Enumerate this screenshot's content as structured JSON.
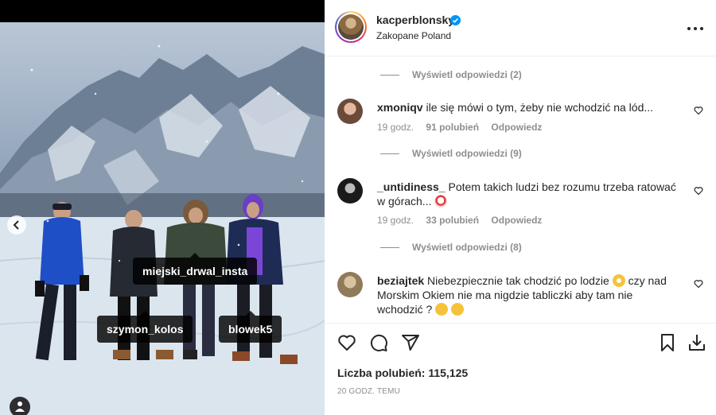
{
  "photo": {
    "tags": [
      "miejski_drwal_insta",
      "szymon_kolos",
      "blowek5"
    ]
  },
  "post": {
    "username": "kacperblonsky",
    "location": "Zakopane Poland",
    "likes_text": "Liczba polubień: 115,125",
    "timestamp": "20 GODZ. TEMU"
  },
  "replies": [
    {
      "label": "Wyświetl odpowiedzi (2)"
    },
    {
      "label": "Wyświetl odpowiedzi (9)"
    },
    {
      "label": "Wyświetl odpowiedzi (8)"
    }
  ],
  "comments": [
    {
      "user": "xmoniqv",
      "text": "ile się mówi o tym, żeby nie wchodzić na lód...",
      "time": "19 godz.",
      "likes": "91 polubień",
      "reply": "Odpowiedz"
    },
    {
      "user": "_untidiness_",
      "text": "Potem takich ludzi bez rozumu trzeba ratować w górach...",
      "time": "19 godz.",
      "likes": "33 polubień",
      "reply": "Odpowiedz"
    },
    {
      "user": "beziajtek",
      "text": "Niebezpiecznie tak chodzić po lodzie",
      "text2": "czy nad Morskim Okiem nie ma nigdzie tabliczki aby tam nie wchodzić ?"
    }
  ],
  "icons": {
    "verified": "verified-badge-icon",
    "more": "more-options-icon",
    "like": "heart-icon",
    "comment": "comment-icon",
    "share": "share-icon",
    "save": "bookmark-icon",
    "download": "download-icon"
  },
  "colors": {
    "verified": "#0095f6",
    "muted": "#8e8e8e",
    "text": "#262626"
  }
}
